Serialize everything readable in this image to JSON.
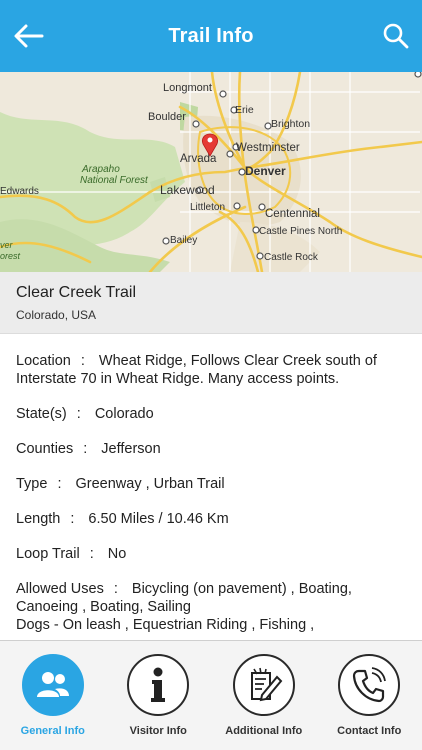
{
  "header": {
    "title": "Trail Info",
    "back_icon": "arrow-left-icon",
    "search_icon": "search-icon"
  },
  "map": {
    "labels": {
      "longmont": "Longmont",
      "erie": "Erie",
      "boulder": "Boulder",
      "brighton": "Brighton",
      "westminster": "Westminster",
      "arvada": "Arvada",
      "arapaho": "Arapaho",
      "national_forest": "National Forest",
      "denver": "Denver",
      "edwards": "Edwards",
      "lakewood": "Lakewood",
      "littleton": "Littleton",
      "centennial": "Centennial",
      "castle_pines_north": "Castle Pines North",
      "bailey": "Bailey",
      "castle_rock": "Castle Rock",
      "river_forest_1": "ver",
      "river_forest_2": "orest"
    },
    "pin_icon": "map-pin-icon"
  },
  "trail": {
    "name": "Clear Creek Trail",
    "region": "Colorado, USA"
  },
  "details": {
    "location_label": "Location",
    "location_value": "Wheat Ridge, Follows Clear Creek south of Interstate 70 in Wheat Ridge. Many access points.",
    "states_label": "State(s)",
    "states_value": "Colorado",
    "counties_label": "Counties",
    "counties_value": "Jefferson",
    "type_label": "Type",
    "type_value": "Greenway , Urban Trail",
    "length_label": "Length",
    "length_value": "6.50 Miles / 10.46 Km",
    "loop_label": "Loop Trail",
    "loop_value": "No",
    "uses_label": "Allowed Uses",
    "uses_value_1": "Bicycling (on pavement) , Boating, Canoeing , Boating, Sailing",
    "uses_value_2": "Dogs - On leash , Equestrian  Riding , Fishing ,"
  },
  "tabs": [
    {
      "label": "General Info",
      "icon": "users-icon",
      "active": true
    },
    {
      "label": "Visitor Info",
      "icon": "info-icon",
      "active": false
    },
    {
      "label": "Additional Info",
      "icon": "edit-document-icon",
      "active": false
    },
    {
      "label": "Contact Info",
      "icon": "phone-icon",
      "active": false
    }
  ],
  "colors": {
    "accent": "#2aa5e3",
    "map_land": "#efe9dc",
    "map_forest": "#c9ddb0",
    "map_highway": "#f2c94c",
    "pin": "#e53935"
  }
}
